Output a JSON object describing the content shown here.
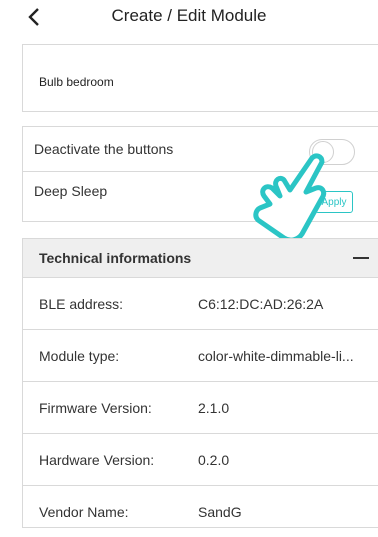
{
  "header": {
    "title": "Create / Edit Module"
  },
  "module": {
    "name": "Bulb bedroom"
  },
  "settings": {
    "deactivate_label": "Deactivate the buttons",
    "deactivate_on": false,
    "deep_sleep_label": "Deep Sleep",
    "apply_label": "Apply"
  },
  "technical": {
    "title": "Technical informations",
    "rows": [
      {
        "label": "BLE address:",
        "value": "C6:12:DC:AD:26:2A"
      },
      {
        "label": "Module type:",
        "value": "color-white-dimmable-li..."
      },
      {
        "label": "Firmware Version:",
        "value": "2.1.0"
      },
      {
        "label": "Hardware Version:",
        "value": "0.2.0"
      },
      {
        "label": "Vendor Name:",
        "value": "SandG"
      }
    ]
  },
  "colors": {
    "accent": "#2bc5c5",
    "border": "#d9d9d9",
    "header_bg": "#efefef"
  }
}
